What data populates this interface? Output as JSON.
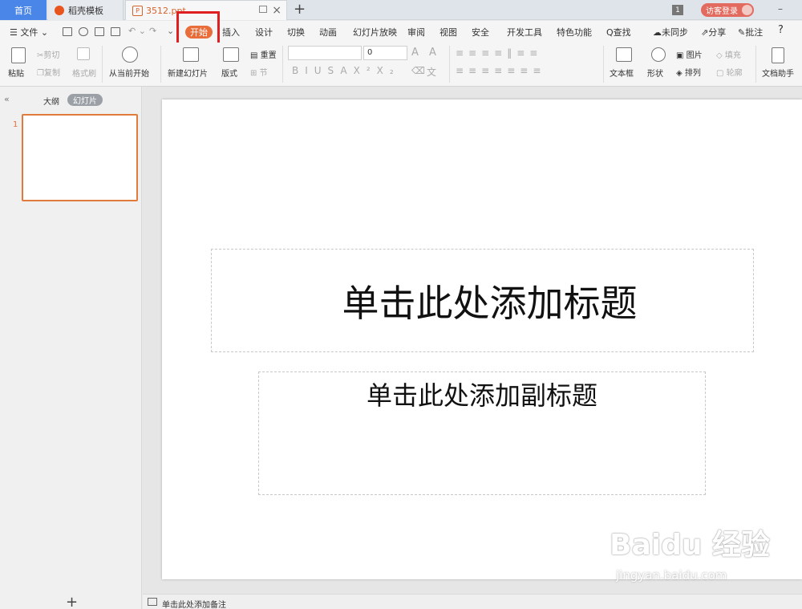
{
  "tabs": {
    "home": "首页",
    "template": "稻壳模板",
    "document": "3512.ppt",
    "add": "+"
  },
  "window": {
    "badge": "1",
    "login": "访客登录",
    "minimize": "–"
  },
  "menu": {
    "file": "☰ 文件 ⌄",
    "start": "开始",
    "insert": "插入",
    "design": "设计",
    "transition": "切换",
    "animation": "动画",
    "slideshow": "幻灯片放映",
    "review": "审阅",
    "view": "视图",
    "security": "安全",
    "devtools": "开发工具",
    "special": "特色功能",
    "search": "Q查找",
    "sync": "未同步",
    "share": "分享",
    "comment": "批注",
    "help": "?"
  },
  "ribbon": {
    "paste": "粘贴",
    "cut": "剪切",
    "copy": "复制",
    "format_painter": "格式刷",
    "play_from_current": "从当前开始",
    "new_slide": "新建幻灯片",
    "layout": "版式",
    "reset": "重置",
    "section": "节",
    "font_size": "0",
    "text_box": "文本框",
    "shape": "形状",
    "picture": "图片",
    "arrange": "排列",
    "fill": "填充",
    "outline": "轮廓",
    "doc_assistant": "文档助手"
  },
  "left_panel": {
    "outline_tab": "大纲",
    "slides_tab": "幻灯片",
    "slide_number": "1",
    "add_slide": "+"
  },
  "slide": {
    "title_placeholder": "单击此处添加标题",
    "subtitle_placeholder": "单击此处添加副标题"
  },
  "notes": {
    "placeholder": "单击此处添加备注"
  },
  "watermark": {
    "logo": "Baidu 经验",
    "url": "jingyan.baidu.com"
  }
}
